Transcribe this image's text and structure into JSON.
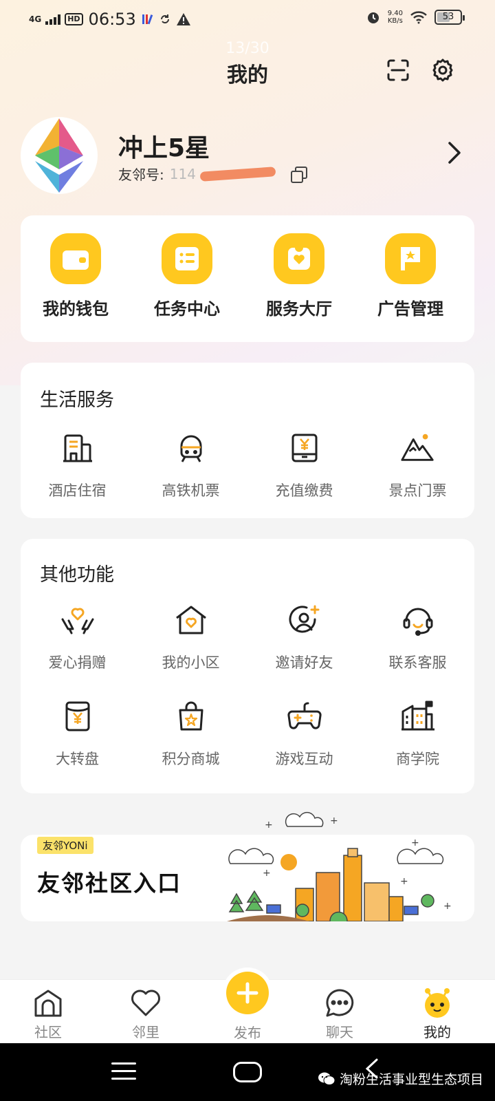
{
  "status_bar": {
    "network": "4G",
    "hd": "HD",
    "time": "06:53",
    "speed_value": "9.40",
    "speed_unit": "KB/s",
    "battery": "53"
  },
  "header": {
    "page_counter": "13/30",
    "title": "我的"
  },
  "profile": {
    "name": "冲上5星",
    "id_label": "友邻号:",
    "id_value": "114"
  },
  "quick_actions": [
    {
      "label": "我的钱包",
      "icon": "wallet-icon"
    },
    {
      "label": "任务中心",
      "icon": "task-list-icon"
    },
    {
      "label": "服务大厅",
      "icon": "heart-bag-icon"
    },
    {
      "label": "广告管理",
      "icon": "flag-icon"
    }
  ],
  "life_services": {
    "title": "生活服务",
    "items": [
      {
        "label": "酒店住宿",
        "icon": "hotel-icon"
      },
      {
        "label": "高铁机票",
        "icon": "train-icon"
      },
      {
        "label": "充值缴费",
        "icon": "recharge-icon"
      },
      {
        "label": "景点门票",
        "icon": "mountain-icon"
      }
    ]
  },
  "other_functions": {
    "title": "其他功能",
    "items": [
      {
        "label": "爱心捐赠",
        "icon": "donation-icon"
      },
      {
        "label": "我的小区",
        "icon": "house-heart-icon"
      },
      {
        "label": "邀请好友",
        "icon": "invite-user-icon"
      },
      {
        "label": "联系客服",
        "icon": "headset-icon"
      },
      {
        "label": "大转盘",
        "icon": "red-envelope-icon"
      },
      {
        "label": "积分商城",
        "icon": "shopping-bag-icon"
      },
      {
        "label": "游戏互动",
        "icon": "gamepad-icon"
      },
      {
        "label": "商学院",
        "icon": "building-flag-icon"
      }
    ]
  },
  "banner": {
    "tag": "友邻YONi",
    "title": "友邻社区入口"
  },
  "bottom_nav": {
    "items": [
      {
        "label": "社区",
        "icon": "home-icon"
      },
      {
        "label": "邻里",
        "icon": "heart-icon"
      },
      {
        "label": "发布",
        "icon": "plus-icon"
      },
      {
        "label": "聊天",
        "icon": "chat-icon"
      },
      {
        "label": "我的",
        "icon": "mascot-icon"
      }
    ],
    "active": "我的"
  },
  "watermark": "淘粉生活事业型生态项目",
  "colors": {
    "accent": "#ffc81f",
    "icon_orange": "#f5a623",
    "text_dark": "#222222",
    "text_gray": "#666666"
  }
}
